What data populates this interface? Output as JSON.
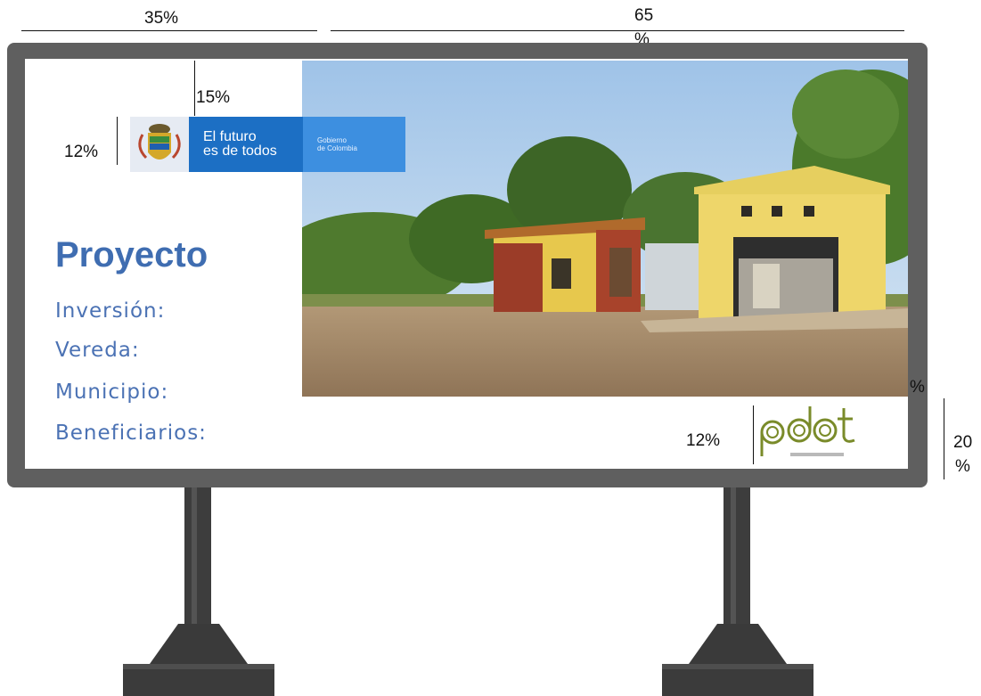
{
  "dimensions": {
    "top_left_width": "35%",
    "top_right_width_line1": "65",
    "top_right_width_line2": "%",
    "gov_logo_offset": "15%",
    "gov_logo_height": "12%",
    "pdet_logo_height": "12%",
    "right_side_height_line1": "20",
    "right_side_height_line2": "%",
    "photo_corner_mark": "%"
  },
  "gov_logo": {
    "line1": "El futuro",
    "line2": "es de todos",
    "line3": "Gobierno",
    "line4": "de Colombia",
    "icon": "coat-of-arms-icon"
  },
  "billboard": {
    "title": "Proyecto",
    "fields": [
      "Inversión:",
      "Vereda:",
      "Municipio:",
      "Beneficiarios:"
    ],
    "photo_icon": "building-photo",
    "pdet_logo_text": "pdet",
    "colors": {
      "frame": "#5f5f5f",
      "title": "#3f6db1",
      "fields": "#4b72b4",
      "gov_blue": "#1c6fc4",
      "pdet_green": "#7a8b2a"
    }
  }
}
